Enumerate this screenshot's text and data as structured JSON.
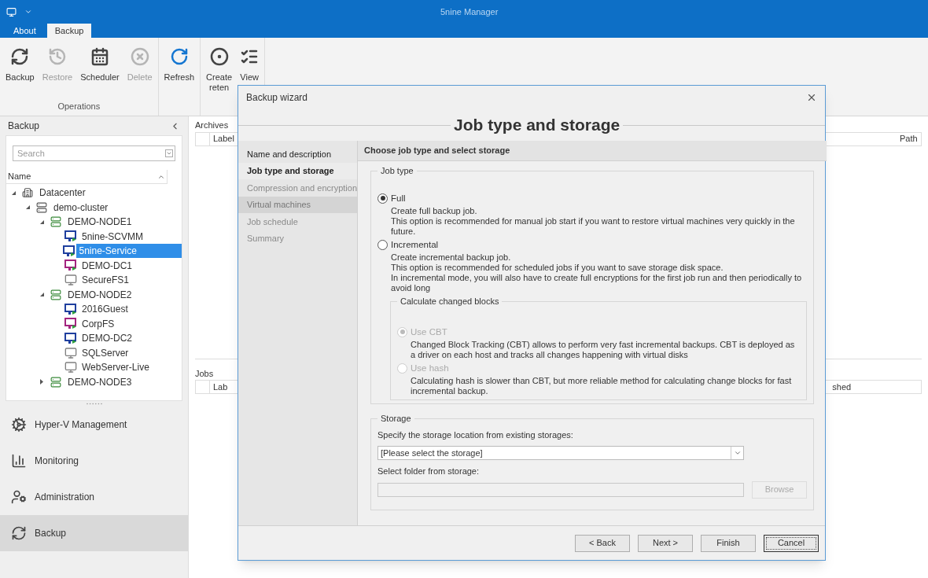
{
  "app": {
    "title": "5nine Manager"
  },
  "ribbon_tabs": [
    {
      "label": "About",
      "selected": false
    },
    {
      "label": "Backup",
      "selected": true
    }
  ],
  "ribbon_groups": [
    {
      "label": "Operations",
      "buttons": [
        {
          "lines": [
            "Backup"
          ],
          "disabled": false
        },
        {
          "lines": [
            "Restore"
          ],
          "disabled": true
        },
        {
          "lines": [
            "Scheduler"
          ],
          "disabled": false
        },
        {
          "lines": [
            "Delete"
          ],
          "disabled": true
        }
      ]
    },
    {
      "buttons": [
        {
          "lines": [
            "Refresh"
          ],
          "disabled": false
        }
      ]
    },
    {
      "buttons": [
        {
          "lines": [
            "Create",
            "reten"
          ],
          "disabled": false
        },
        {
          "lines": [
            "View"
          ],
          "disabled": false
        }
      ]
    }
  ],
  "sidebar": {
    "title": "Backup",
    "search": {
      "placeholder": "Search"
    },
    "tree_header": "Name",
    "tree": [
      {
        "label": "Datacenter",
        "kind": "datacenter",
        "expanded": true,
        "selected": false,
        "children": [
          {
            "label": "demo-cluster",
            "kind": "cluster",
            "expanded": true,
            "selected": false,
            "children": [
              {
                "label": "DEMO-NODE1",
                "kind": "host",
                "expanded": true,
                "selected": false,
                "children": [
                  {
                    "label": "5nine-SCVMM",
                    "kind": "vm",
                    "color": "#1f3f9e",
                    "selected": false
                  },
                  {
                    "label": "5nine-Service",
                    "kind": "vm",
                    "color": "#1f3f9e",
                    "selected": true
                  },
                  {
                    "label": "DEMO-DC1",
                    "kind": "vm",
                    "color": "#a3247f",
                    "selected": false
                  },
                  {
                    "label": "SecureFS1",
                    "kind": "vm_off",
                    "color": "#808080",
                    "selected": false
                  }
                ]
              },
              {
                "label": "DEMO-NODE2",
                "kind": "host",
                "expanded": true,
                "selected": false,
                "children": [
                  {
                    "label": "2016Guest",
                    "kind": "vm",
                    "color": "#1f3f9e",
                    "selected": false
                  },
                  {
                    "label": "CorpFS",
                    "kind": "vm",
                    "color": "#a3247f",
                    "selected": false
                  },
                  {
                    "label": "DEMO-DC2",
                    "kind": "vm",
                    "color": "#1f3f9e",
                    "selected": false
                  },
                  {
                    "label": "SQLServer",
                    "kind": "vm_off",
                    "color": "#808080",
                    "selected": false
                  },
                  {
                    "label": "WebServer-Live",
                    "kind": "vm_off",
                    "color": "#808080",
                    "selected": false
                  }
                ]
              },
              {
                "label": "DEMO-NODE3",
                "kind": "host",
                "expanded": false,
                "selected": false
              }
            ]
          }
        ]
      }
    ],
    "nav": [
      {
        "label": "Hyper-V Management",
        "selected": false
      },
      {
        "label": "Monitoring",
        "selected": false
      },
      {
        "label": "Administration",
        "selected": false
      },
      {
        "label": "Backup",
        "selected": true
      }
    ]
  },
  "archives": {
    "title": "Archives",
    "columns": [
      "Label",
      "Path"
    ]
  },
  "jobs": {
    "title": "Jobs",
    "columns": [
      "Lab",
      "shed"
    ]
  },
  "wizard": {
    "title": "Backup wizard",
    "heading": "Job type and storage",
    "steps": [
      {
        "label": "Name and description",
        "selected": false,
        "disabled": false
      },
      {
        "label": "Job type and storage",
        "selected": true,
        "disabled": false
      },
      {
        "label": "Compression and encryption",
        "selected": false,
        "disabled": true
      },
      {
        "label": "Virtual machines",
        "selected": false,
        "disabled": true
      },
      {
        "label": "Job schedule",
        "selected": false,
        "disabled": true
      },
      {
        "label": "Summary",
        "selected": false,
        "disabled": true
      }
    ],
    "panel_title": "Choose job type and select storage",
    "job_type": {
      "title": "Job type",
      "options": [
        {
          "label": "Full",
          "selected": true,
          "description": [
            "Create full backup job.",
            "This option is recommended for manual job start if you want to restore virtual machines very quickly in the future."
          ]
        },
        {
          "label": "Incremental",
          "selected": false,
          "description": [
            "Create incremental backup job.",
            "This option is recommended for scheduled jobs if you want to save storage disk space.",
            "In incremental mode, you will also have to create full encryptions for the first job run and then periodically to avoid long"
          ]
        }
      ],
      "changed_blocks": {
        "title": "Calculate changed blocks",
        "disabled": true,
        "options": [
          {
            "label": "Use CBT",
            "selected": true,
            "description": [
              "Changed Block Tracking (CBT) allows to perform very fast incremental backups. CBT is deployed as a driver on each host and tracks all changes happening with virtual disks"
            ]
          },
          {
            "label": "Use hash",
            "selected": false,
            "description": [
              "Calculating hash is slower than CBT, but more reliable method for calculating change blocks for fast incremental backup."
            ]
          }
        ]
      }
    },
    "storage": {
      "title": "Storage",
      "location_label": "Specify the storage location from existing storages:",
      "location_value": "[Please select the storage]",
      "folder_label": "Select folder from storage:",
      "browse": {
        "label": "Browse",
        "disabled": true
      }
    },
    "buttons": [
      {
        "label": "< Back",
        "default": false
      },
      {
        "label": "Next >",
        "default": false
      },
      {
        "label": "Finish",
        "default": false
      },
      {
        "label": "Cancel",
        "default": true
      }
    ]
  }
}
